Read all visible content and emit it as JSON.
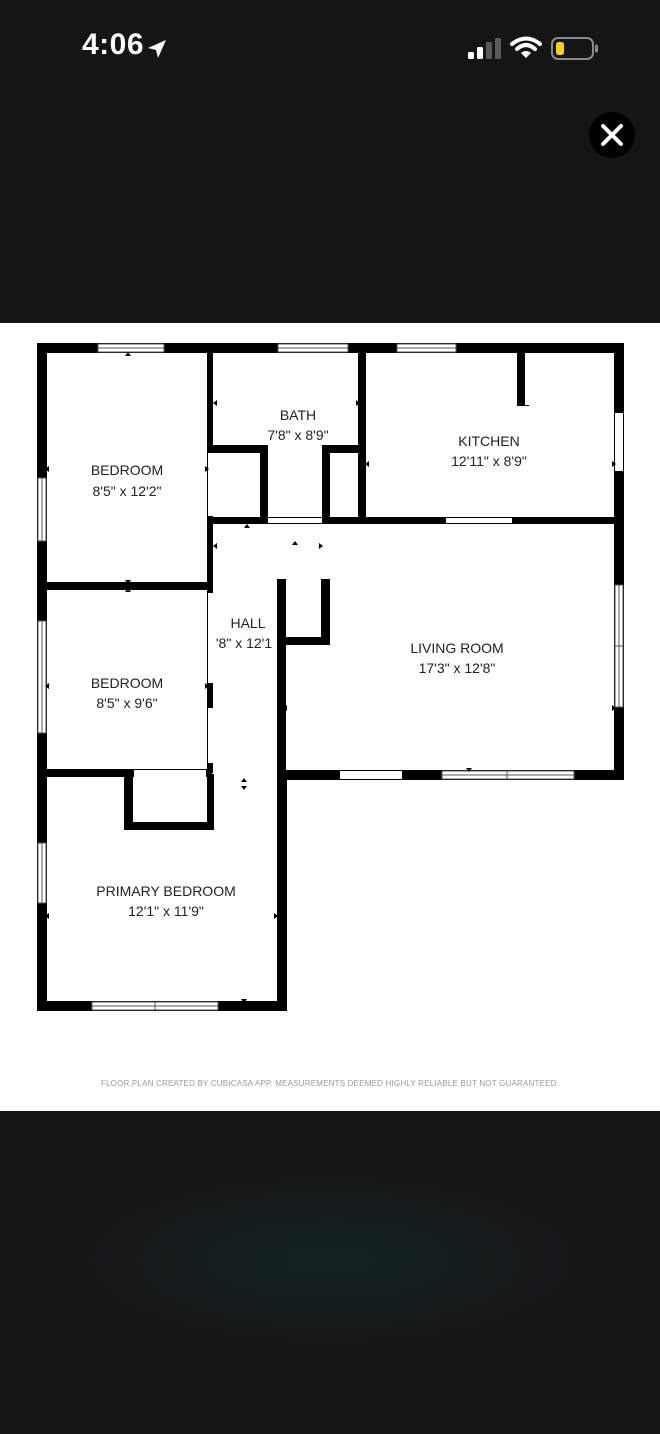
{
  "status_bar": {
    "time": "4:06",
    "icons": [
      "location-arrow-icon",
      "cellular-signal-icon",
      "wifi-icon",
      "battery-icon"
    ],
    "battery_color": "#f5d020"
  },
  "viewer": {
    "close_icon": "close-icon"
  },
  "floor_plan": {
    "rooms": [
      {
        "name": "BEDROOM",
        "dimensions": "8'5\" x 12'2\""
      },
      {
        "name": "BATH",
        "dimensions": "7'8\" x 8'9\""
      },
      {
        "name": "KITCHEN",
        "dimensions": "12'11\" x 8'9\""
      },
      {
        "name": "HALL",
        "dimensions": "'8\" x 12'1"
      },
      {
        "name": "LIVING ROOM",
        "dimensions": "17'3\" x 12'8\""
      },
      {
        "name": "BEDROOM",
        "dimensions": "8'5\" x 9'6\""
      },
      {
        "name": "PRIMARY BEDROOM",
        "dimensions": "12'1\" x 11'9\""
      }
    ],
    "disclaimer": "FLOOR PLAN CREATED BY CUBICASA APP. MEASUREMENTS DEEMED HIGHLY RELIABLE BUT NOT GUARANTEED."
  }
}
